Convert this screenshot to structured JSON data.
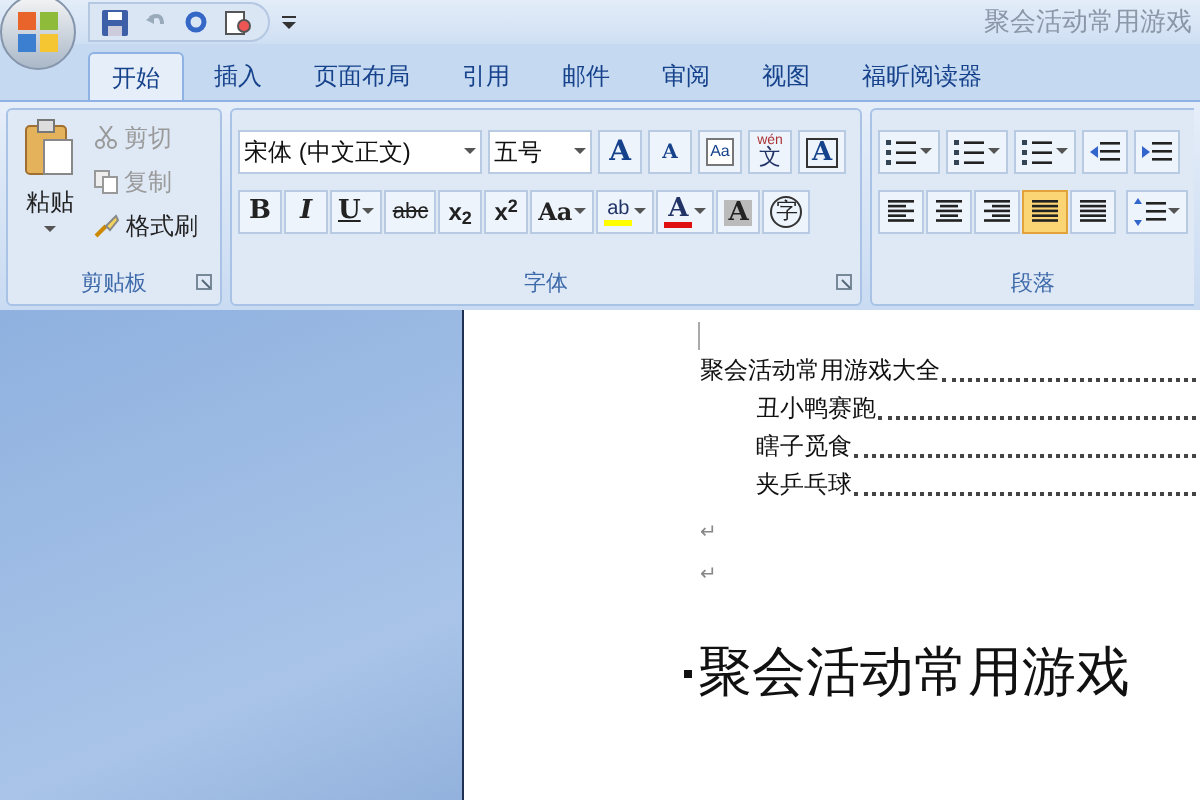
{
  "title_bar": {
    "title": "聚会活动常用游戏"
  },
  "tabs": [
    {
      "label": "开始",
      "selected": true
    },
    {
      "label": "插入",
      "selected": false
    },
    {
      "label": "页面布局",
      "selected": false
    },
    {
      "label": "引用",
      "selected": false
    },
    {
      "label": "邮件",
      "selected": false
    },
    {
      "label": "审阅",
      "selected": false
    },
    {
      "label": "视图",
      "selected": false
    },
    {
      "label": "福昕阅读器",
      "selected": false
    }
  ],
  "clipboard": {
    "paste": "粘贴",
    "items": [
      {
        "label": "剪切",
        "kind": "cut",
        "disabled": true
      },
      {
        "label": "复制",
        "kind": "copy",
        "disabled": true
      },
      {
        "label": "格式刷",
        "kind": "brush",
        "disabled": false
      }
    ],
    "group_label": "剪贴板"
  },
  "font": {
    "name": "宋体 (中文正文)",
    "size": "五号",
    "row1": [
      {
        "kind": "grow",
        "label": "A"
      },
      {
        "kind": "shrink",
        "label": "A"
      },
      {
        "kind": "clear",
        "label": "Aa"
      },
      {
        "kind": "phonetic",
        "label": "文",
        "ruby": "wén"
      },
      {
        "kind": "border",
        "label": "A"
      }
    ],
    "row2": [
      {
        "kind": "bold",
        "label": "B"
      },
      {
        "kind": "italic",
        "label": "I"
      },
      {
        "kind": "underline",
        "label": "U"
      },
      {
        "kind": "strike",
        "label": "abc"
      },
      {
        "kind": "sub",
        "label": "x$_{2}$"
      },
      {
        "kind": "sup",
        "label": "x$^{2}$"
      },
      {
        "kind": "case",
        "label": "Aa"
      },
      {
        "kind": "highlight",
        "label": "ab"
      },
      {
        "kind": "color",
        "label": "A"
      },
      {
        "kind": "shading",
        "label": "A"
      },
      {
        "kind": "enclose",
        "label": "字"
      }
    ],
    "group_label": "字体"
  },
  "paragraph": {
    "align": [
      {
        "kind": "left",
        "selected": false
      },
      {
        "kind": "center",
        "selected": false
      },
      {
        "kind": "right",
        "selected": false
      },
      {
        "kind": "justify",
        "selected": true
      },
      {
        "kind": "distributed",
        "selected": false
      }
    ],
    "group_label": "段落"
  },
  "document": {
    "toc": [
      {
        "title": "聚会活动常用游戏大全",
        "children": [
          {
            "title": "丑小鸭赛跑"
          },
          {
            "title": "瞎子觅食"
          },
          {
            "title": "夹乒乓球"
          }
        ]
      }
    ],
    "marks": [
      "↵",
      "↵"
    ],
    "heading": "聚会活动常用游戏"
  }
}
